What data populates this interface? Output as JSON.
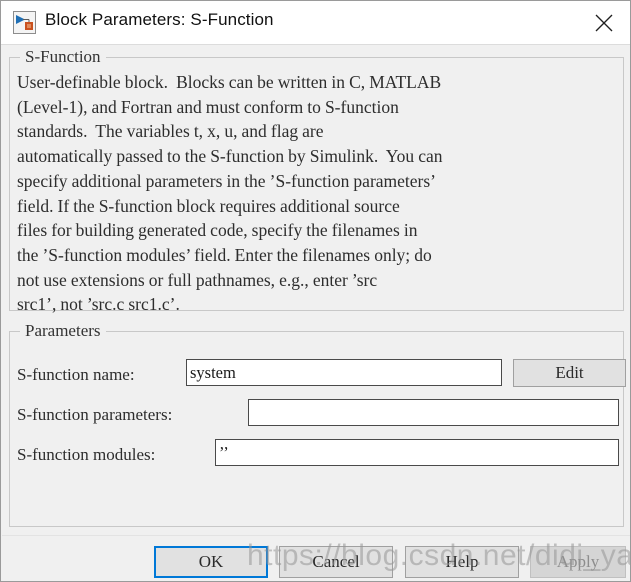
{
  "window": {
    "title": "Block Parameters: S-Function",
    "icon_name": "simulink-block-icon",
    "close_label": "✕"
  },
  "sfunction_group": {
    "legend": "S-Function",
    "description": "User-definable block.  Blocks can be written in C, MATLAB\n(Level-1), and Fortran and must conform to S-function\nstandards.  The variables t, x, u, and flag are\nautomatically passed to the S-function by Simulink.  You can\nspecify additional parameters in the ’S-function parameters’\nfield. If the S-function block requires additional source\nfiles for building generated code, specify the filenames in\nthe ’S-function modules’ field. Enter the filenames only; do\nnot use extensions or full pathnames, e.g., enter ’src\nsrc1’, not ’src.c src1.c’."
  },
  "parameters_group": {
    "legend": "Parameters",
    "fields": [
      {
        "label": "S-function name:",
        "value": "system",
        "placeholder": ""
      },
      {
        "label": "S-function parameters:",
        "value": "",
        "placeholder": ""
      },
      {
        "label": "S-function modules:",
        "value": "’’",
        "placeholder": ""
      }
    ],
    "edit_button": "Edit"
  },
  "footer": {
    "ok": "OK",
    "cancel": "Cancel",
    "help": "Help",
    "apply": "Apply"
  },
  "watermark": {
    "text": "https://blog.csdn.net/didi_ya"
  },
  "colors": {
    "dialog_background": "#f0f0f0",
    "titlebar_background": "#ffffff",
    "accent_focus": "#0078d7",
    "input_background": "#ffffff",
    "button_background": "#e1e1e1",
    "group_border": "#c8c8c8",
    "text": "#2d2d2d"
  }
}
